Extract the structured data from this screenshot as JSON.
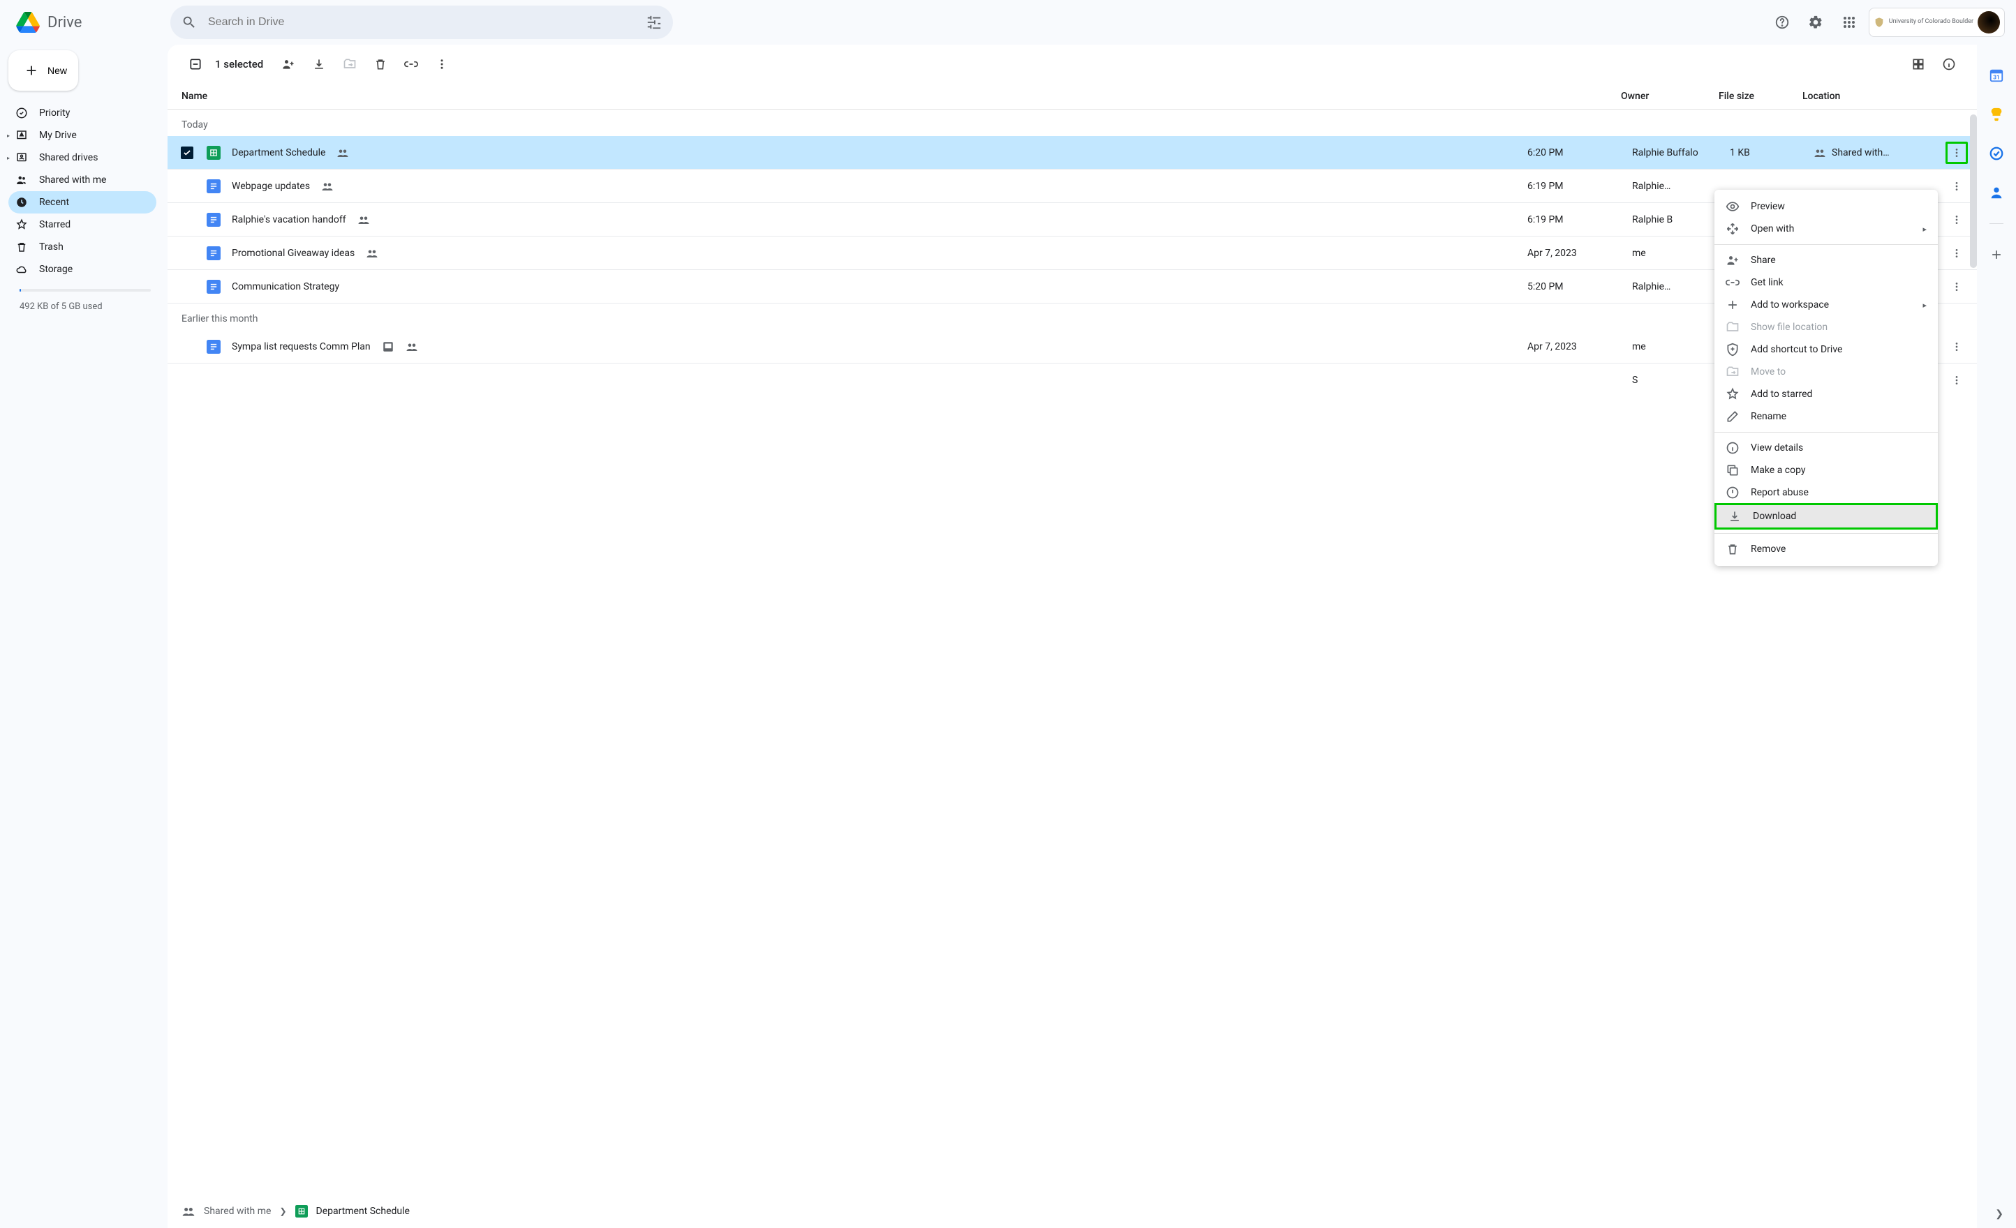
{
  "app": {
    "name": "Drive"
  },
  "search": {
    "placeholder": "Search in Drive"
  },
  "account": {
    "org": "University of Colorado Boulder"
  },
  "newButton": "New",
  "sidebar": {
    "items": [
      {
        "label": "Priority"
      },
      {
        "label": "My Drive"
      },
      {
        "label": "Shared drives"
      },
      {
        "label": "Shared with me"
      },
      {
        "label": "Recent"
      },
      {
        "label": "Starred"
      },
      {
        "label": "Trash"
      },
      {
        "label": "Storage"
      }
    ],
    "storageText": "492 KB of 5 GB used"
  },
  "toolbar": {
    "selected": "1 selected"
  },
  "columns": {
    "name": "Name",
    "owner": "Owner",
    "size": "File size",
    "location": "Location"
  },
  "groups": {
    "today": "Today",
    "earlier": "Earlier this month"
  },
  "rows": [
    {
      "name": "Department Schedule",
      "shared": true,
      "date": "6:20 PM",
      "owner": "Ralphie Buffalo",
      "size": "1 KB",
      "location": "Shared with…",
      "selected": true,
      "type": "sheet"
    },
    {
      "name": "Webpage updates",
      "shared": true,
      "date": "6:19 PM",
      "owner": "Ralphie…",
      "size": "",
      "location": "",
      "type": "doc"
    },
    {
      "name": "Ralphie's vacation handoff",
      "shared": true,
      "date": "6:19 PM",
      "owner": "Ralphie B",
      "size": "",
      "location": "",
      "type": "doc"
    },
    {
      "name": "Promotional Giveaway ideas",
      "shared": true,
      "date": "Apr 7, 2023",
      "owner": "me",
      "size": "",
      "location": "",
      "type": "doc"
    },
    {
      "name": "Communication Strategy",
      "shared": false,
      "date": "5:20 PM",
      "owner": "Ralphie…",
      "size": "",
      "location": "",
      "type": "doc"
    }
  ],
  "rowB": {
    "name": "Sympa list requests Comm Plan",
    "shared": true,
    "date": "Apr 7, 2023",
    "owner": "me",
    "location": "S",
    "type": "jam"
  },
  "rowsExtraLoc": "S",
  "ctx": {
    "preview": "Preview",
    "openWith": "Open with",
    "share": "Share",
    "getLink": "Get link",
    "addWorkspace": "Add to workspace",
    "showLoc": "Show file location",
    "shortcut": "Add shortcut to Drive",
    "moveTo": "Move to",
    "star": "Add to starred",
    "rename": "Rename",
    "details": "View details",
    "copy": "Make a copy",
    "report": "Report abuse",
    "download": "Download",
    "remove": "Remove"
  },
  "breadcrumb": {
    "root": "Shared with me",
    "current": "Department Schedule"
  }
}
